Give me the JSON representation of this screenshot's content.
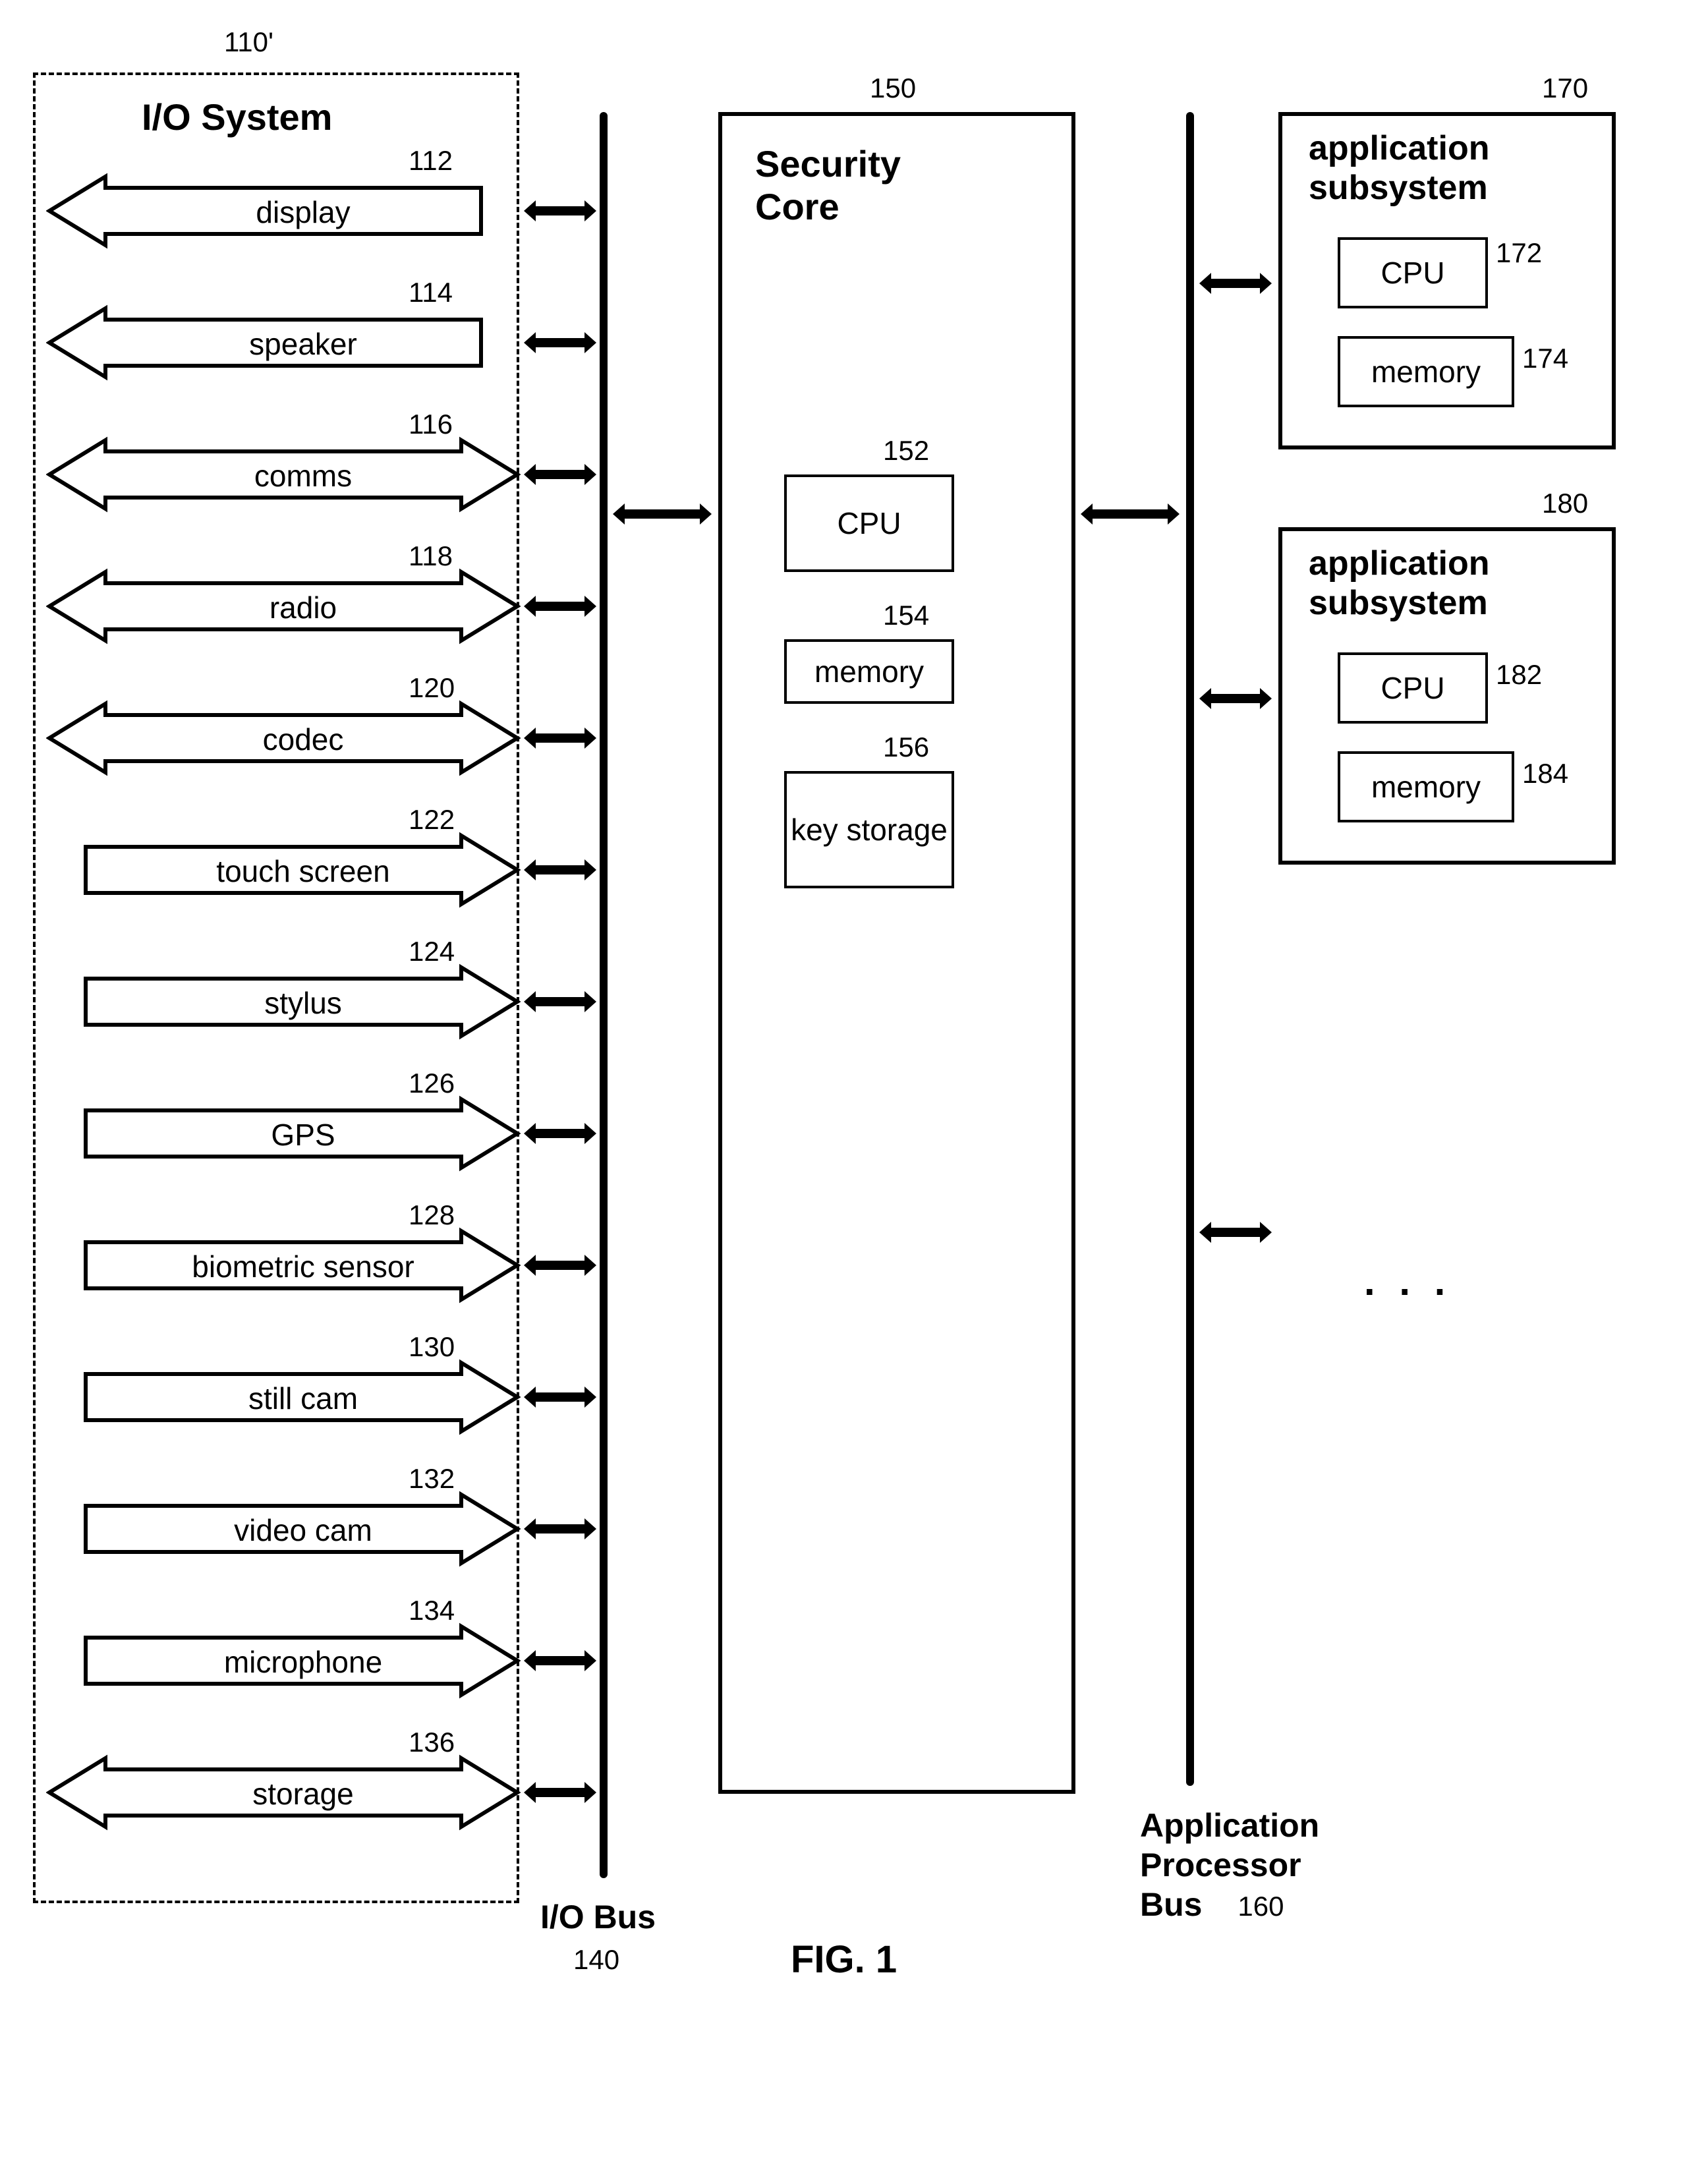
{
  "ioSystem": {
    "ref": "110'",
    "title": "I/O System",
    "items": [
      {
        "label": "display",
        "ref": "112",
        "dir": "left"
      },
      {
        "label": "speaker",
        "ref": "114",
        "dir": "left"
      },
      {
        "label": "comms",
        "ref": "116",
        "dir": "both"
      },
      {
        "label": "radio",
        "ref": "118",
        "dir": "both"
      },
      {
        "label": "codec",
        "ref": "120",
        "dir": "both"
      },
      {
        "label": "touch screen",
        "ref": "122",
        "dir": "right"
      },
      {
        "label": "stylus",
        "ref": "124",
        "dir": "right"
      },
      {
        "label": "GPS",
        "ref": "126",
        "dir": "right"
      },
      {
        "label": "biometric sensor",
        "ref": "128",
        "dir": "right"
      },
      {
        "label": "still cam",
        "ref": "130",
        "dir": "right"
      },
      {
        "label": "video cam",
        "ref": "132",
        "dir": "right"
      },
      {
        "label": "microphone",
        "ref": "134",
        "dir": "right"
      },
      {
        "label": "storage",
        "ref": "136",
        "dir": "both"
      }
    ]
  },
  "ioBus": {
    "label": "I/O Bus",
    "ref": "140"
  },
  "securityCore": {
    "title": "Security Core",
    "ref": "150",
    "cpu": {
      "label": "CPU",
      "ref": "152"
    },
    "memory": {
      "label": "memory",
      "ref": "154"
    },
    "key": {
      "label": "key storage",
      "ref": "156"
    }
  },
  "appBus": {
    "label1": "Application",
    "label2": "Processor",
    "label3": "Bus",
    "ref": "160"
  },
  "app1": {
    "title1": "application",
    "title2": "subsystem",
    "ref": "170",
    "cpu": {
      "label": "CPU",
      "ref": "172"
    },
    "memory": {
      "label": "memory",
      "ref": "174"
    }
  },
  "app2": {
    "title1": "application",
    "title2": "subsystem",
    "ref": "180",
    "cpu": {
      "label": "CPU",
      "ref": "182"
    },
    "memory": {
      "label": "memory",
      "ref": "184"
    }
  },
  "ellipsis": ". . .",
  "figure": "FIG. 1"
}
